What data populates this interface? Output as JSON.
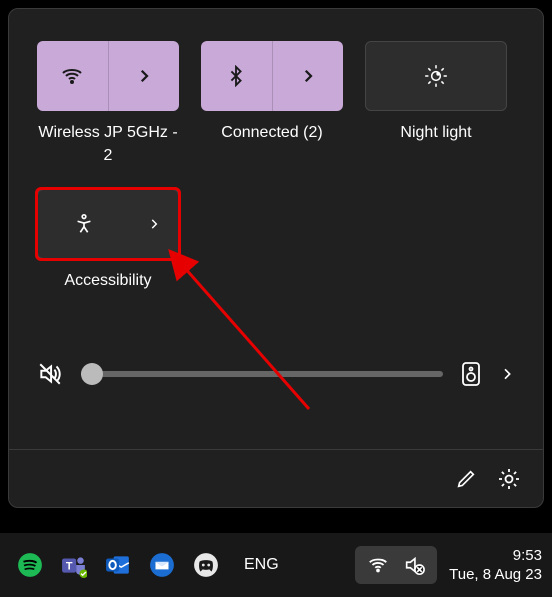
{
  "tiles": {
    "wifi": {
      "label": "Wireless JP 5GHz - 2",
      "active": true
    },
    "bluetooth": {
      "label": "Connected (2)",
      "active": true
    },
    "nightlight": {
      "label": "Night light",
      "active": false
    },
    "accessibility": {
      "label": "Accessibility",
      "active": false
    }
  },
  "volume": {
    "level": 3,
    "muted": true
  },
  "taskbar": {
    "lang": "ENG",
    "time": "9:53",
    "date": "Tue, 8 Aug 23"
  }
}
